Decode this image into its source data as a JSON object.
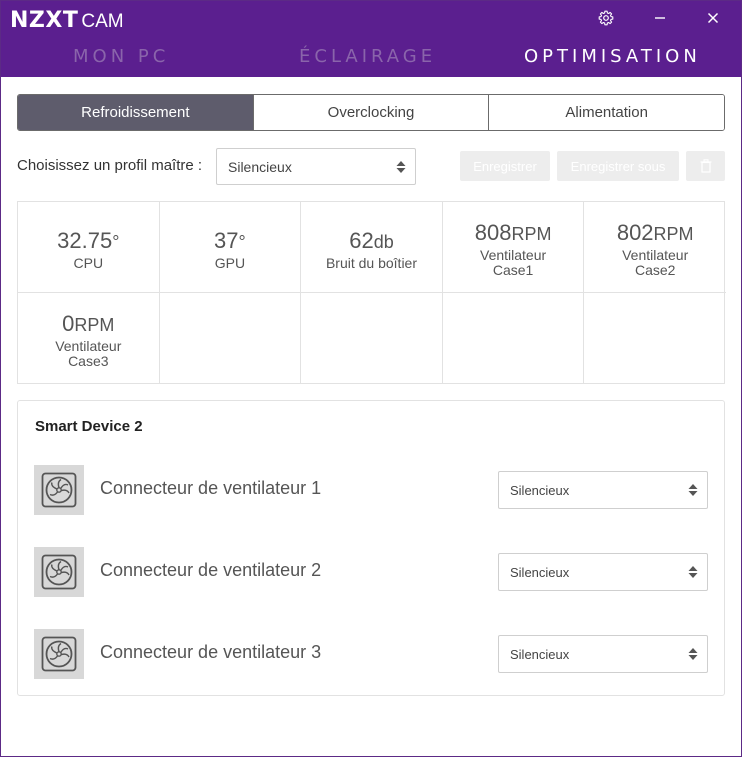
{
  "app": {
    "logo_brand": "NZXT",
    "logo_product": "CAM",
    "brand_color": "#5b1f8f",
    "window_controls": [
      "gear-icon",
      "minimize-icon",
      "close-icon"
    ]
  },
  "nav": {
    "tabs": [
      {
        "label": "MON PC",
        "active": false
      },
      {
        "label": "ÉCLAIRAGE",
        "active": false
      },
      {
        "label": "OPTIMISATION",
        "active": true
      }
    ]
  },
  "subtabs": [
    {
      "label": "Refroidissement",
      "active": true
    },
    {
      "label": "Overclocking",
      "active": false
    },
    {
      "label": "Alimentation",
      "active": false
    }
  ],
  "profile": {
    "label": "Choisissez un profil maître :",
    "selected": "Silencieux",
    "save_label": "Enregistrer",
    "save_as_label": "Enregistrer sous",
    "delete_icon": "trash-icon"
  },
  "stats": [
    {
      "value": "32.75",
      "unit": "°",
      "label": "CPU"
    },
    {
      "value": "37",
      "unit": "°",
      "label": "GPU"
    },
    {
      "value": "62",
      "unit": "db",
      "label": "Bruit du boîtier"
    },
    {
      "value": "808",
      "unit": "RPM",
      "label": "Ventilateur Case1"
    },
    {
      "value": "802",
      "unit": "RPM",
      "label": "Ventilateur Case2"
    },
    {
      "value": "0",
      "unit": "RPM",
      "label": "Ventilateur Case3"
    }
  ],
  "device": {
    "title": "Smart Device 2",
    "fans": [
      {
        "label": "Connecteur de ventilateur 1",
        "mode": "Silencieux",
        "icon": "fan-icon"
      },
      {
        "label": "Connecteur de ventilateur 2",
        "mode": "Silencieux",
        "icon": "fan-icon"
      },
      {
        "label": "Connecteur de ventilateur 3",
        "mode": "Silencieux",
        "icon": "fan-icon"
      }
    ]
  }
}
